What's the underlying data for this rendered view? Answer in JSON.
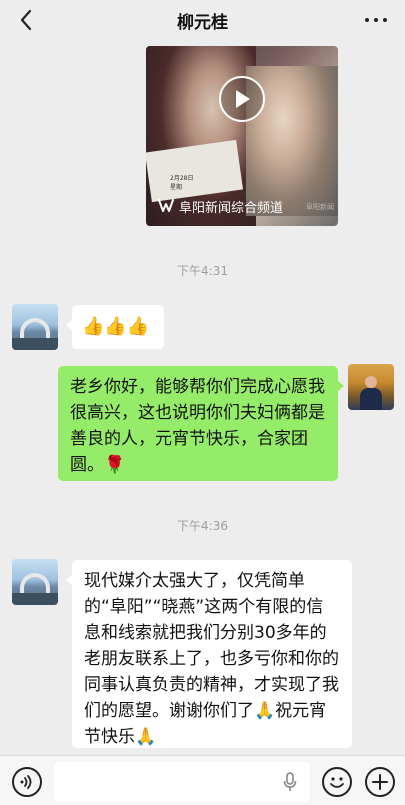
{
  "header": {
    "title": "柳元桂",
    "back_icon": "chevron-left-icon",
    "more_icon": "more-dots-icon"
  },
  "video": {
    "source_label": "阜阳新闻综合频道",
    "date_text": "2月28日\n星期",
    "watermark": "阜阳新闻",
    "play_icon": "play-icon"
  },
  "messages": [
    {
      "type": "time",
      "text": "下午4:31"
    },
    {
      "type": "left",
      "sender_avatar": "bridge-avatar",
      "text": "👍👍👍"
    },
    {
      "type": "right",
      "sender_avatar": "person-avatar",
      "text": "老乡你好，能够帮你们完成心愿我很高兴，这也说明你们夫妇俩都是善良的人，元宵节快乐，合家团圆。🌹"
    },
    {
      "type": "time",
      "text": "下午4:36"
    },
    {
      "type": "left",
      "sender_avatar": "bridge-avatar",
      "text": "现代媒介太强大了，仅凭简单的“阜阳”“晓燕”这两个有限的信息和线索就把我们分别30多年的老朋友联系上了，也多亏你和你的同事认真负责的精神，才实现了我们的愿望。谢谢你们了🙏祝元宵节快乐🙏"
    }
  ],
  "input_bar": {
    "voice_icon": "voice-icon",
    "mic_icon": "microphone-icon",
    "emoji_icon": "emoji-icon",
    "plus_icon": "plus-icon",
    "input_value": ""
  },
  "colors": {
    "background": "#ededed",
    "bubble_right": "#95ec69",
    "bubble_left": "#ffffff",
    "timestamp": "#9e9e9e"
  }
}
